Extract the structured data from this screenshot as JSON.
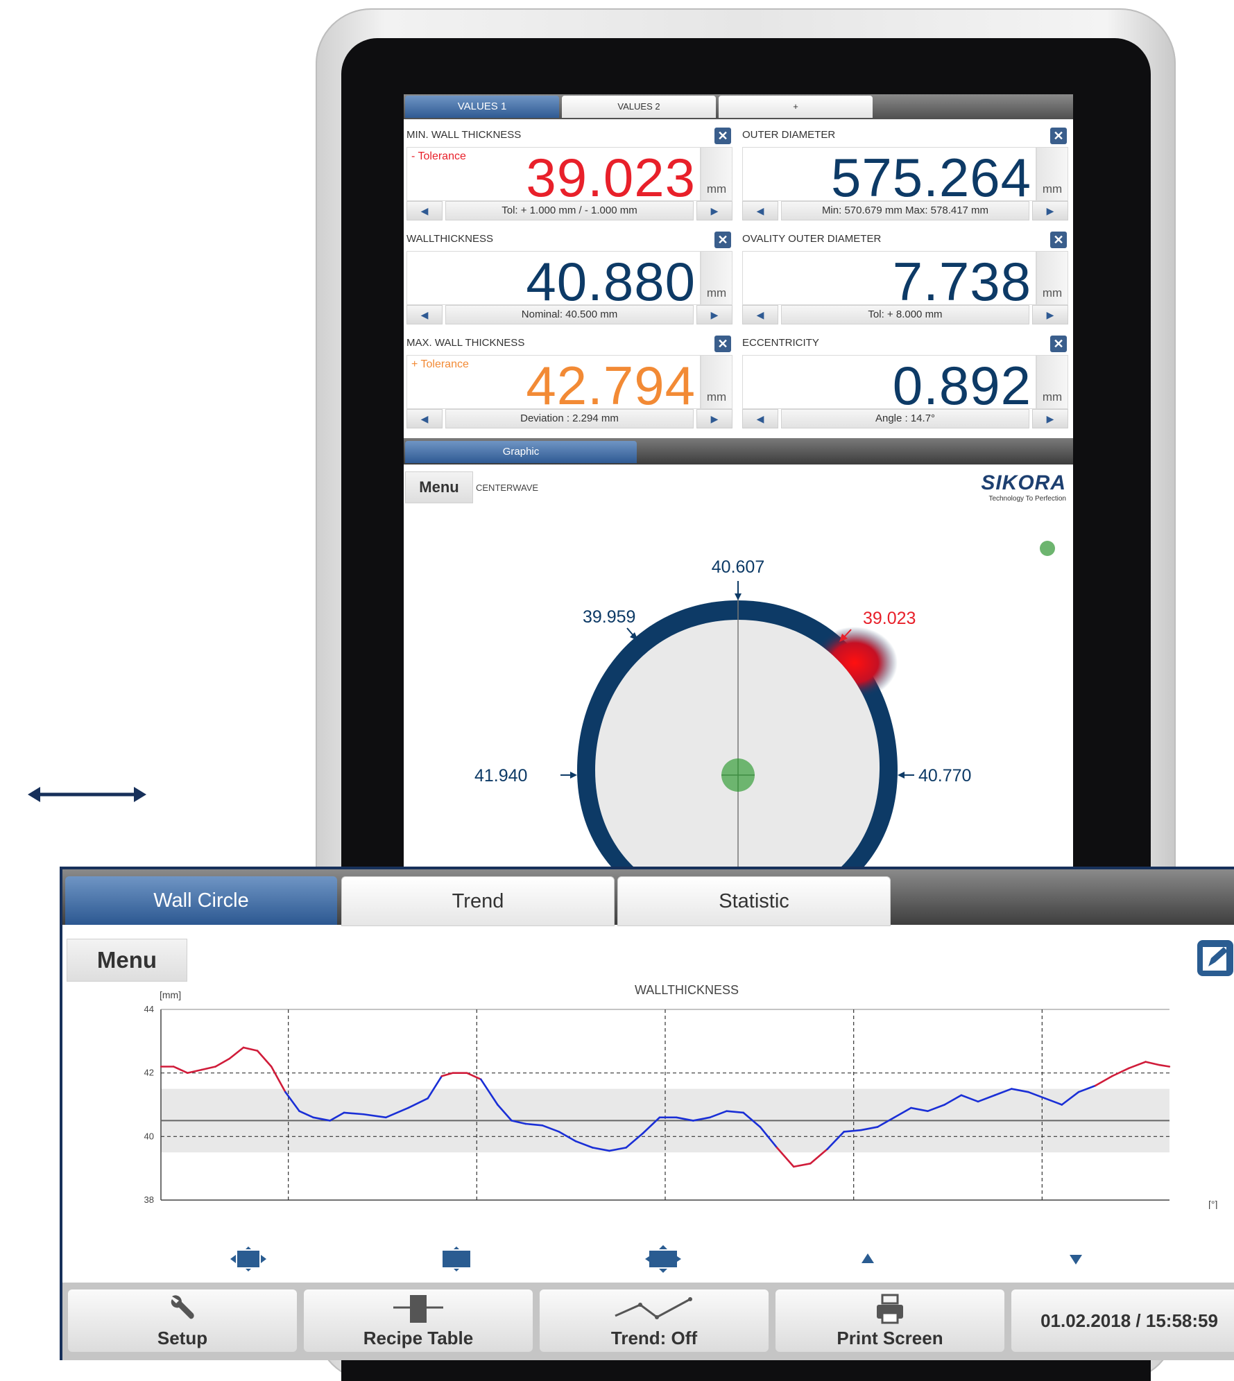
{
  "screen": {
    "tabs": [
      "VALUES 1",
      "VALUES 2",
      "+"
    ],
    "panels": [
      {
        "title": "MIN. WALL THICKNESS",
        "tolerance": "- Tolerance",
        "value": "39.023",
        "unit": "mm",
        "info": "Tol: + 1.000 mm / - 1.000 mm",
        "color": "#e8202a",
        "tol_color": "#e8202a"
      },
      {
        "title": "OUTER DIAMETER",
        "tolerance": "",
        "value": "575.264",
        "unit": "mm",
        "info": "Min: 570.679 mm Max: 578.417 mm",
        "color": "#0d3a66",
        "tol_color": "#0d3a66"
      },
      {
        "title": "WALLTHICKNESS",
        "tolerance": "",
        "value": "40.880",
        "unit": "mm",
        "info": "Nominal: 40.500 mm",
        "color": "#0d3a66",
        "tol_color": "#0d3a66"
      },
      {
        "title": "OVALITY OUTER DIAMETER",
        "tolerance": "",
        "value": "7.738",
        "unit": "mm",
        "info": "Tol: + 8.000 mm",
        "color": "#0d3a66",
        "tol_color": "#0d3a66"
      },
      {
        "title": "MAX. WALL THICKNESS",
        "tolerance": "+ Tolerance",
        "value": "42.794",
        "unit": "mm",
        "info": "Deviation : 2.294 mm",
        "color": "#f28a35",
        "tol_color": "#f28a35"
      },
      {
        "title": "ECCENTRICITY",
        "tolerance": "",
        "value": "0.892",
        "unit": "mm",
        "info": "Angle : 14.7°",
        "color": "#0d3a66",
        "tol_color": "#0d3a66"
      }
    ],
    "graphic_tab": "Graphic",
    "menu_label": "Menu",
    "mode": "CENTERWAVE",
    "brand": "SIKORA",
    "brand_tagline": "Technology To Perfection",
    "wall_labels": {
      "top": "40.607",
      "top_left": "39.959",
      "top_right": "39.023",
      "left": "41.940",
      "right": "40.770"
    }
  },
  "overlay": {
    "tabs": [
      "Wall Circle",
      "Trend",
      "Statistic"
    ],
    "menu_label": "Menu",
    "bottom_buttons": [
      {
        "label": "Setup",
        "icon": "wrench-icon"
      },
      {
        "label": "Recipe Table",
        "icon": "recipe-table-icon"
      },
      {
        "label": "Trend: Off",
        "icon": "trend-line-icon"
      },
      {
        "label": "Print Screen",
        "icon": "printer-icon"
      }
    ],
    "datetime": "01.02.2018 / 15:58:59"
  },
  "chart_data": {
    "type": "line",
    "title": "WALLTHICKNESS",
    "ylabel": "[mm]",
    "xlabel": "[°]",
    "xlim": [
      -180.54,
      180.54
    ],
    "ylim": [
      38,
      44
    ],
    "x_ticks": [
      "-180.54",
      "-134.93",
      "-67.47",
      "0",
      "67.47",
      "134.93",
      "180.54"
    ],
    "y_ticks": [
      "44",
      "42",
      "40",
      "38"
    ],
    "nominal": 40.5,
    "upper_limit": 41.5,
    "lower_limit": 39.5,
    "colors": {
      "normal": "#1a2fd6",
      "out_of_tolerance": "#d01c3a",
      "band": "#e8e8e8"
    },
    "series": [
      {
        "x": [
          -180.5,
          -176,
          -171,
          -166,
          -161,
          -156,
          -151,
          -146,
          -141,
          -136,
          -131,
          -126,
          -120,
          -115,
          -108,
          -100,
          -92,
          -85,
          -80,
          -76,
          -71,
          -66,
          -60,
          -55,
          -50,
          -44,
          -38,
          -32,
          -26,
          -20,
          -14,
          -8,
          -2,
          4,
          10,
          16,
          22,
          28,
          34,
          40,
          46,
          52,
          58,
          64,
          70,
          76,
          82,
          88,
          94,
          100,
          106,
          112,
          118,
          124,
          130,
          136,
          142,
          148,
          154,
          160,
          166,
          172,
          177,
          180.5
        ],
        "y": [
          42.2,
          42.2,
          42.0,
          42.1,
          42.2,
          42.45,
          42.8,
          42.7,
          42.2,
          41.4,
          40.8,
          40.6,
          40.5,
          40.75,
          40.7,
          40.6,
          40.9,
          41.2,
          41.9,
          42.0,
          42.0,
          41.8,
          41.0,
          40.5,
          40.4,
          40.35,
          40.15,
          39.85,
          39.65,
          39.55,
          39.65,
          40.1,
          40.6,
          40.6,
          40.5,
          40.6,
          40.8,
          40.75,
          40.3,
          39.65,
          39.05,
          39.15,
          39.6,
          40.15,
          40.2,
          40.3,
          40.6,
          40.9,
          40.8,
          41.0,
          41.3,
          41.1,
          41.3,
          41.5,
          41.4,
          41.2,
          41.0,
          41.4,
          41.6,
          41.9,
          42.15,
          42.35,
          42.25,
          42.2
        ]
      }
    ]
  }
}
